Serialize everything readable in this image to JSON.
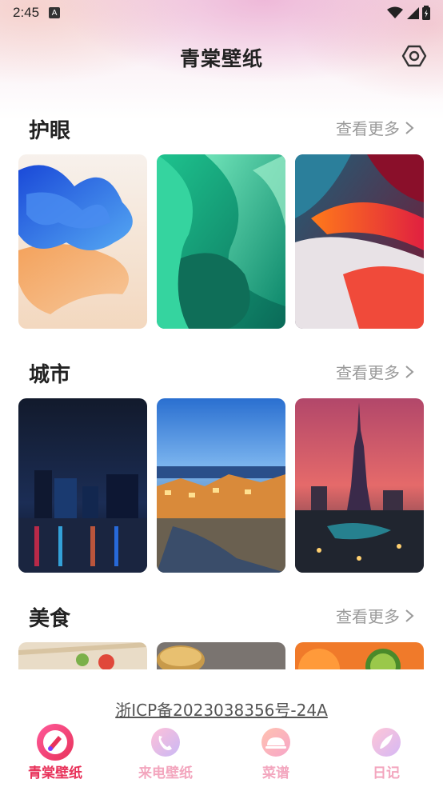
{
  "status_bar": {
    "time": "2:45",
    "notif_icon": "A"
  },
  "header": {
    "title": "青棠壁纸"
  },
  "sections": [
    {
      "title": "护眼",
      "more": "查看更多"
    },
    {
      "title": "城市",
      "more": "查看更多"
    },
    {
      "title": "美食",
      "more": "查看更多"
    }
  ],
  "footer": {
    "icp": "浙ICP备2023038356号-24A"
  },
  "tabs": [
    {
      "label": "青棠壁纸",
      "active": true
    },
    {
      "label": "来电壁纸",
      "active": false
    },
    {
      "label": "菜谱",
      "active": false
    },
    {
      "label": "日记",
      "active": false
    }
  ],
  "colors": {
    "accent": "#e8325a",
    "inactive_tab": "#f3a6be",
    "more_text": "#9a9a9a"
  }
}
